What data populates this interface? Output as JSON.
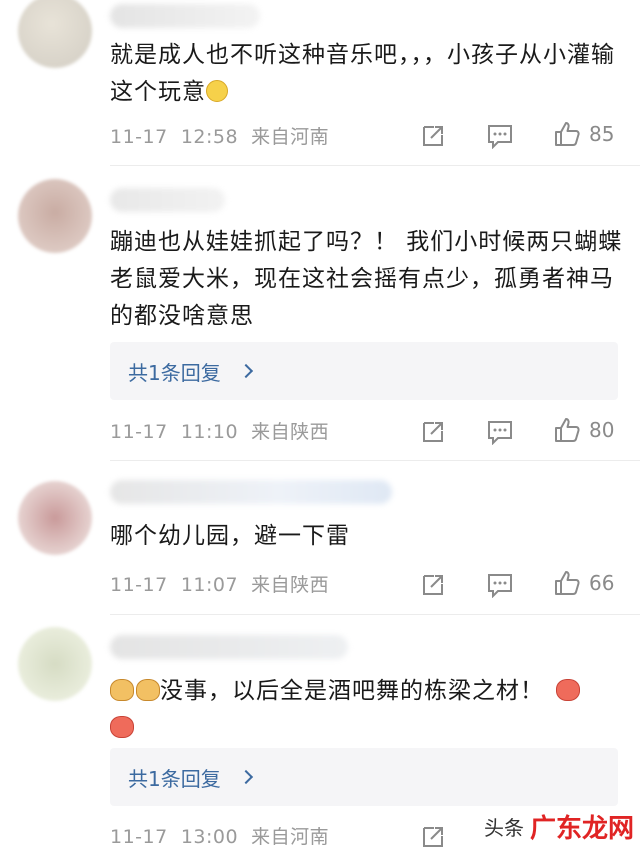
{
  "comments": [
    {
      "text": "就是成人也不听这种音乐吧，，，小孩子从小灌输这个玩意",
      "emoji_after": "rolling-eyes-emoji",
      "date": "11-17",
      "time": "12:58",
      "location": "来自河南",
      "likes": "85",
      "reply_label": null
    },
    {
      "text": "蹦迪也从娃娃抓起了吗？！ 我们小时候两只蝴蝶老鼠爱大米，现在这社会摇有点少，孤勇者神马的都没啥意思",
      "date": "11-17",
      "time": "11:10",
      "location": "来自陕西",
      "likes": "80",
      "reply_label": "共1条回复"
    },
    {
      "text": "哪个幼儿园，避一下雷",
      "date": "11-17",
      "time": "11:07",
      "location": "来自陕西",
      "likes": "66",
      "reply_label": null
    },
    {
      "text": "没事，以后全是酒吧舞的栋梁之材！",
      "date": "11-17",
      "time": "13:00",
      "location": "来自河南",
      "likes": "",
      "reply_label": "共1条回复"
    }
  ],
  "watermark": {
    "source": "头条",
    "brand": "广东龙网"
  },
  "colors": {
    "link": "#3c6aa0",
    "meta": "#9a9a9a",
    "text": "#1a1a1a",
    "reply_bg": "#f5f5f7"
  }
}
